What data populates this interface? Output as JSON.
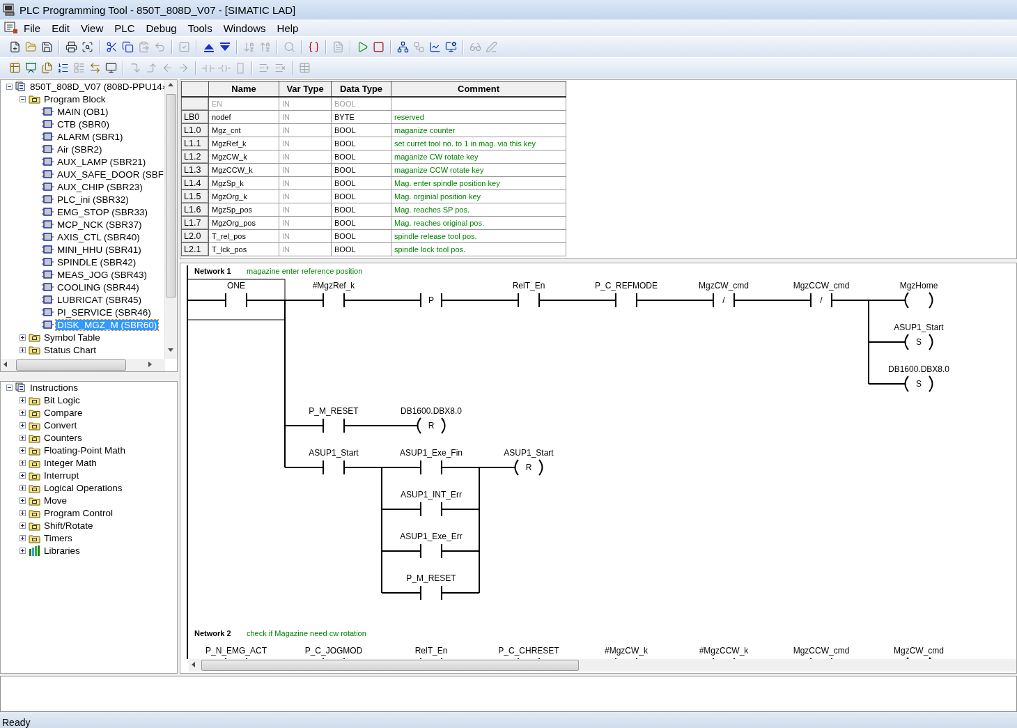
{
  "window": {
    "title": "PLC Programming Tool - 850T_808D_V07 - [SIMATIC LAD]"
  },
  "menu": [
    "File",
    "Edit",
    "View",
    "PLC",
    "Debug",
    "Tools",
    "Windows",
    "Help"
  ],
  "toolbar_1": [
    {
      "disabled": false
    },
    {
      "disabled": false
    },
    {
      "disabled": false
    },
    {
      "disabled": false
    },
    {
      "disabled": false
    },
    {
      "disabled": false
    },
    {
      "disabled": false
    },
    {
      "disabled": true
    },
    {
      "disabled": true
    },
    {
      "disabled": true
    },
    {
      "disabled": false
    },
    {
      "disabled": false
    },
    {
      "disabled": true
    },
    {
      "disabled": true
    },
    {
      "disabled": true
    },
    {
      "disabled": false
    },
    {
      "disabled": true
    },
    {
      "disabled": false
    },
    {
      "disabled": false
    },
    {
      "disabled": false
    },
    {
      "disabled": true
    },
    {
      "disabled": false
    },
    {
      "disabled": false
    },
    {
      "disabled": true
    },
    {
      "disabled": true
    }
  ],
  "toolbar_2": [
    {
      "disabled": false
    },
    {
      "disabled": false
    },
    {
      "disabled": false
    },
    {
      "disabled": false
    },
    {
      "disabled": true
    },
    {
      "disabled": false
    },
    {
      "disabled": false
    },
    {
      "disabled": true
    },
    {
      "disabled": true
    },
    {
      "disabled": true
    },
    {
      "disabled": true
    },
    {
      "disabled": true
    },
    {
      "disabled": true
    },
    {
      "disabled": true
    },
    {
      "disabled": true
    },
    {
      "disabled": true
    },
    {
      "disabled": true
    }
  ],
  "project_tree": {
    "items": [
      {
        "label": "850T_808D_V07 (808D-PPU14›",
        "kind": "project",
        "expanded": true,
        "selected": false,
        "children": [
          {
            "label": "Program Block",
            "kind": "folder",
            "expanded": true,
            "selected": false,
            "children": [
              {
                "label": "MAIN (OB1)",
                "kind": "block",
                "selected": false
              },
              {
                "label": "CTB (SBR0)",
                "kind": "block",
                "selected": false
              },
              {
                "label": "ALARM (SBR1)",
                "kind": "block",
                "selected": false
              },
              {
                "label": "Air (SBR2)",
                "kind": "block",
                "selected": false
              },
              {
                "label": "AUX_LAMP (SBR21)",
                "kind": "block",
                "selected": false
              },
              {
                "label": "AUX_SAFE_DOOR (SBF",
                "kind": "block",
                "selected": false
              },
              {
                "label": "AUX_CHIP (SBR23)",
                "kind": "block",
                "selected": false
              },
              {
                "label": "PLC_ini (SBR32)",
                "kind": "block",
                "selected": false
              },
              {
                "label": "EMG_STOP (SBR33)",
                "kind": "block",
                "selected": false
              },
              {
                "label": "MCP_NCK (SBR37)",
                "kind": "block",
                "selected": false
              },
              {
                "label": "AXIS_CTL (SBR40)",
                "kind": "block",
                "selected": false
              },
              {
                "label": "MINI_HHU (SBR41)",
                "kind": "block",
                "selected": false
              },
              {
                "label": "SPINDLE (SBR42)",
                "kind": "block",
                "selected": false
              },
              {
                "label": "MEAS_JOG (SBR43)",
                "kind": "block",
                "selected": false
              },
              {
                "label": "COOLING (SBR44)",
                "kind": "block",
                "selected": false
              },
              {
                "label": "LUBRICAT (SBR45)",
                "kind": "block",
                "selected": false
              },
              {
                "label": "PI_SERVICE (SBR46)",
                "kind": "block",
                "selected": false
              },
              {
                "label": "DISK_MGZ_M (SBR60)",
                "kind": "block",
                "selected": true
              }
            ]
          },
          {
            "label": "Symbol Table",
            "kind": "folder",
            "expanded": false,
            "selected": false
          },
          {
            "label": "Status Chart",
            "kind": "folder",
            "expanded": false,
            "selected": false
          }
        ]
      }
    ]
  },
  "instructions_tree": {
    "items": [
      {
        "label": "Instructions",
        "kind": "project",
        "expanded": true,
        "selected": false,
        "children": [
          {
            "label": "Bit Logic",
            "kind": "folder",
            "expanded": false,
            "selected": false
          },
          {
            "label": "Compare",
            "kind": "folder",
            "expanded": false,
            "selected": false
          },
          {
            "label": "Convert",
            "kind": "folder",
            "expanded": false,
            "selected": false
          },
          {
            "label": "Counters",
            "kind": "folder",
            "expanded": false,
            "selected": false
          },
          {
            "label": "Floating-Point Math",
            "kind": "folder",
            "expanded": false,
            "selected": false
          },
          {
            "label": "Integer Math",
            "kind": "folder",
            "expanded": false,
            "selected": false
          },
          {
            "label": "Interrupt",
            "kind": "folder",
            "expanded": false,
            "selected": false
          },
          {
            "label": "Logical Operations",
            "kind": "folder",
            "expanded": false,
            "selected": false
          },
          {
            "label": "Move",
            "kind": "folder",
            "expanded": false,
            "selected": false
          },
          {
            "label": "Program Control",
            "kind": "folder",
            "expanded": false,
            "selected": false
          },
          {
            "label": "Shift/Rotate",
            "kind": "folder",
            "expanded": false,
            "selected": false
          },
          {
            "label": "Timers",
            "kind": "folder",
            "expanded": false,
            "selected": false
          },
          {
            "label": "Libraries",
            "kind": "library",
            "expanded": false,
            "selected": false
          }
        ]
      }
    ]
  },
  "variable_table": {
    "columns": [
      "Name",
      "Var Type",
      "Data Type",
      "Comment"
    ],
    "rows": [
      {
        "name": "EN",
        "var_type": "IN",
        "data_type": "BOOL",
        "disabled": true
      },
      {
        "address": "LB0",
        "name": "nodef",
        "var_type": "IN",
        "data_type": "BYTE",
        "comment": "reserved",
        "disabled": false
      },
      {
        "address": "L1.0",
        "name": "Mgz_cnt",
        "var_type": "IN",
        "data_type": "BOOL",
        "comment": "maganize counter",
        "disabled": false
      },
      {
        "address": "L1.1",
        "name": "MgzRef_k",
        "var_type": "IN",
        "data_type": "BOOL",
        "comment": "set curret tool no. to 1 in mag. via this key",
        "disabled": false
      },
      {
        "address": "L1.2",
        "name": "MgzCW_k",
        "var_type": "IN",
        "data_type": "BOOL",
        "comment": "maganize CW rotate key",
        "disabled": false
      },
      {
        "address": "L1.3",
        "name": "MgzCCW_k",
        "var_type": "IN",
        "data_type": "BOOL",
        "comment": "maganize CCW rotate key",
        "disabled": false
      },
      {
        "address": "L1.4",
        "name": "MgzSp_k",
        "var_type": "IN",
        "data_type": "BOOL",
        "comment": "Mag. enter spindle position key",
        "disabled": false
      },
      {
        "address": "L1.5",
        "name": "MgzOrg_k",
        "var_type": "IN",
        "data_type": "BOOL",
        "comment": "Mag. orginial position key",
        "disabled": false
      },
      {
        "address": "L1.6",
        "name": "MgzSp_pos",
        "var_type": "IN",
        "data_type": "BOOL",
        "comment": "Mag. reaches SP pos.",
        "disabled": false
      },
      {
        "address": "L1.7",
        "name": "MgzOrg_pos",
        "var_type": "IN",
        "data_type": "BOOL",
        "comment": "Mag. reaches original pos.",
        "disabled": false
      },
      {
        "address": "L2.0",
        "name": "T_rel_pos",
        "var_type": "IN",
        "data_type": "BOOL",
        "comment": "spindle release tool pos.",
        "disabled": false
      },
      {
        "address": "L2.1",
        "name": "T_lck_pos",
        "var_type": "IN",
        "data_type": "BOOL",
        "comment": "spindle lock tool pos.",
        "disabled": false
      }
    ]
  },
  "networks": [
    {
      "title": "Network 1",
      "comment": "magazine enter reference position",
      "elements": [
        {
          "kind": "contact",
          "label": "ONE"
        },
        {
          "kind": "contact",
          "label": "#MgzRef_k"
        },
        {
          "kind": "edge",
          "symbol": "P"
        },
        {
          "kind": "contact",
          "label": "RelT_En"
        },
        {
          "kind": "contact",
          "label": "P_C_REFMODE"
        },
        {
          "kind": "contact",
          "label": "MgzCW_cmd",
          "symbol": "/"
        },
        {
          "kind": "contact",
          "label": "MgzCCW_cmd",
          "symbol": "/"
        },
        {
          "kind": "coil",
          "label": "MgzHome"
        },
        {
          "kind": "coil",
          "label": "ASUP1_Start",
          "symbol": "S"
        },
        {
          "kind": "coil",
          "label": "DB1600.DBX8.0",
          "symbol": "S"
        },
        {
          "kind": "contact",
          "label": "P_M_RESET"
        },
        {
          "kind": "coil",
          "label": "DB1600.DBX8.0",
          "symbol": "R"
        },
        {
          "kind": "contact",
          "label": "ASUP1_Start"
        },
        {
          "kind": "contact",
          "label": "ASUP1_Exe_Fin"
        },
        {
          "kind": "contact",
          "label": "ASUP1_INT_Err"
        },
        {
          "kind": "contact",
          "label": "ASUP1_Exe_Err"
        },
        {
          "kind": "contact",
          "label": "P_M_RESET"
        },
        {
          "kind": "coil",
          "label": "ASUP1_Start",
          "symbol": "R"
        }
      ]
    },
    {
      "title": "Network 2",
      "comment": "check if Magazine need cw rotation",
      "elements": [
        {
          "kind": "contact",
          "label": "P_N_EMG_ACT"
        },
        {
          "kind": "contact",
          "label": "P_C_JOGMOD"
        },
        {
          "kind": "contact",
          "label": "RelT_En"
        },
        {
          "kind": "contact",
          "label": "P_C_CHRESET"
        },
        {
          "kind": "contact",
          "label": "#MgzCW_k"
        },
        {
          "kind": "contact",
          "label": "#MgzCCW_k"
        },
        {
          "kind": "contact",
          "label": "MgzCCW_cmd"
        },
        {
          "kind": "coil",
          "label": "MgzCW_cmd"
        }
      ]
    }
  ],
  "status_bar": "Ready"
}
